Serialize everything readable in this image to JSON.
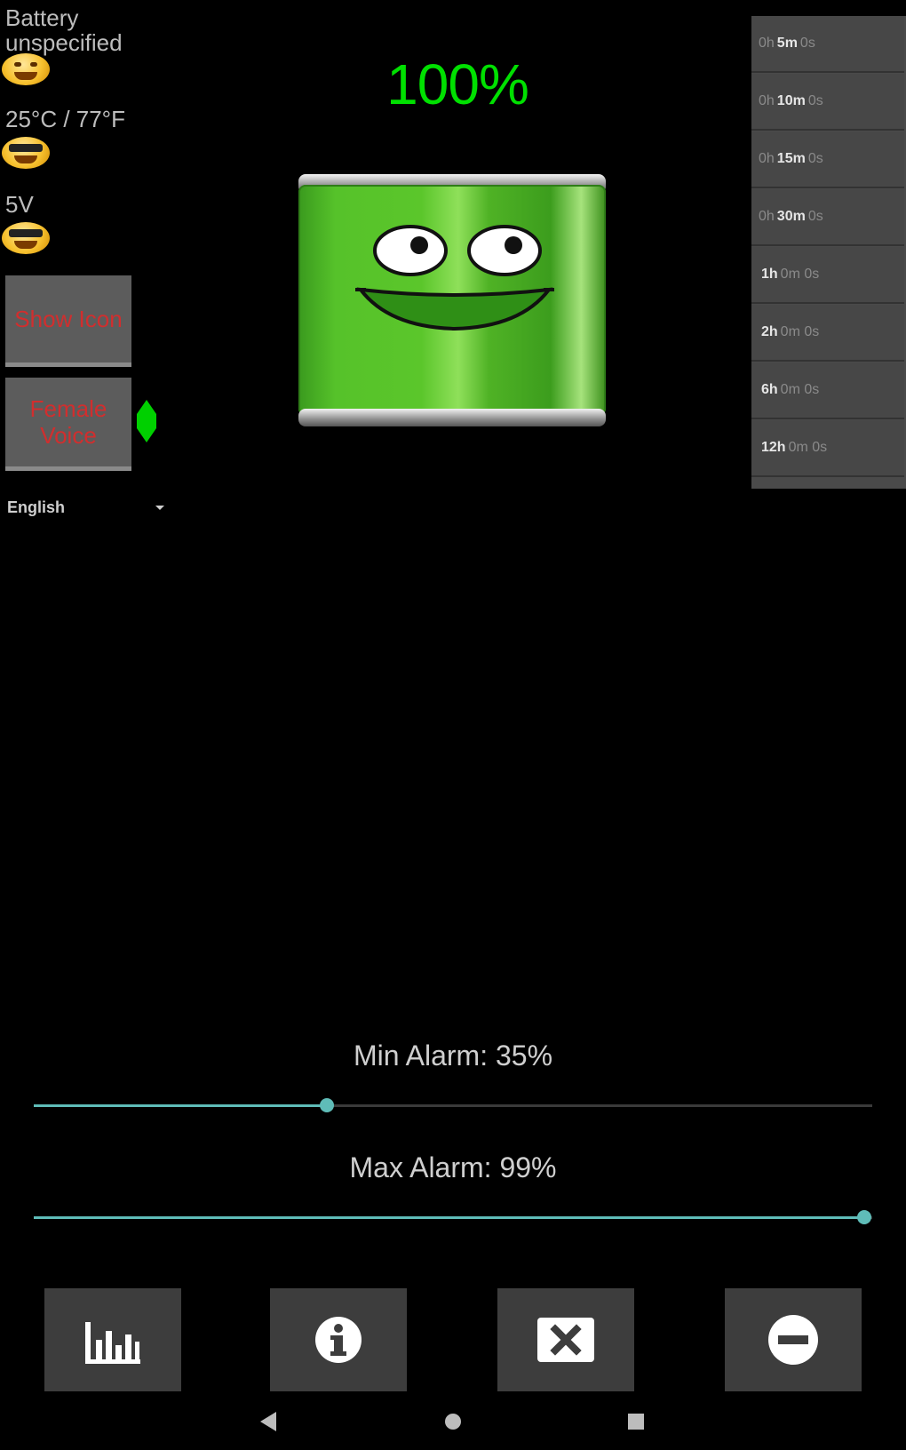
{
  "status": {
    "health_line1": "Battery",
    "health_line2": "unspecified",
    "temperature": "25°C / 77°F",
    "voltage": "5V"
  },
  "buttons": {
    "show_icon": "Show Icon",
    "female_voice_line1": "Female",
    "female_voice_line2": "Voice"
  },
  "language": {
    "selected": "English"
  },
  "battery": {
    "percent_label": "100%",
    "level": 1.0
  },
  "time_list": [
    {
      "pre": "0h",
      "main": "5m",
      "post": "0s"
    },
    {
      "pre": "0h",
      "main": "10m",
      "post": "0s"
    },
    {
      "pre": "0h",
      "main": "15m",
      "post": "0s"
    },
    {
      "pre": "0h",
      "main": "30m",
      "post": "0s"
    },
    {
      "pre": "",
      "main": "1h",
      "post": "0m 0s"
    },
    {
      "pre": "",
      "main": "2h",
      "post": "0m 0s"
    },
    {
      "pre": "",
      "main": "6h",
      "post": "0m 0s"
    },
    {
      "pre": "",
      "main": "12h",
      "post": "0m 0s"
    }
  ],
  "alarms": {
    "min_label": "Min Alarm: 35%",
    "min_value": 0.35,
    "max_label": "Max Alarm: 99%",
    "max_value": 0.99
  },
  "toolbar": {
    "icons": [
      "bar-chart-icon",
      "info-icon",
      "close-box-icon",
      "minus-circle-icon"
    ]
  },
  "colors": {
    "accent_green": "#00e000",
    "slider_teal": "#5fbcb8",
    "button_text_red": "#d12e2e"
  }
}
